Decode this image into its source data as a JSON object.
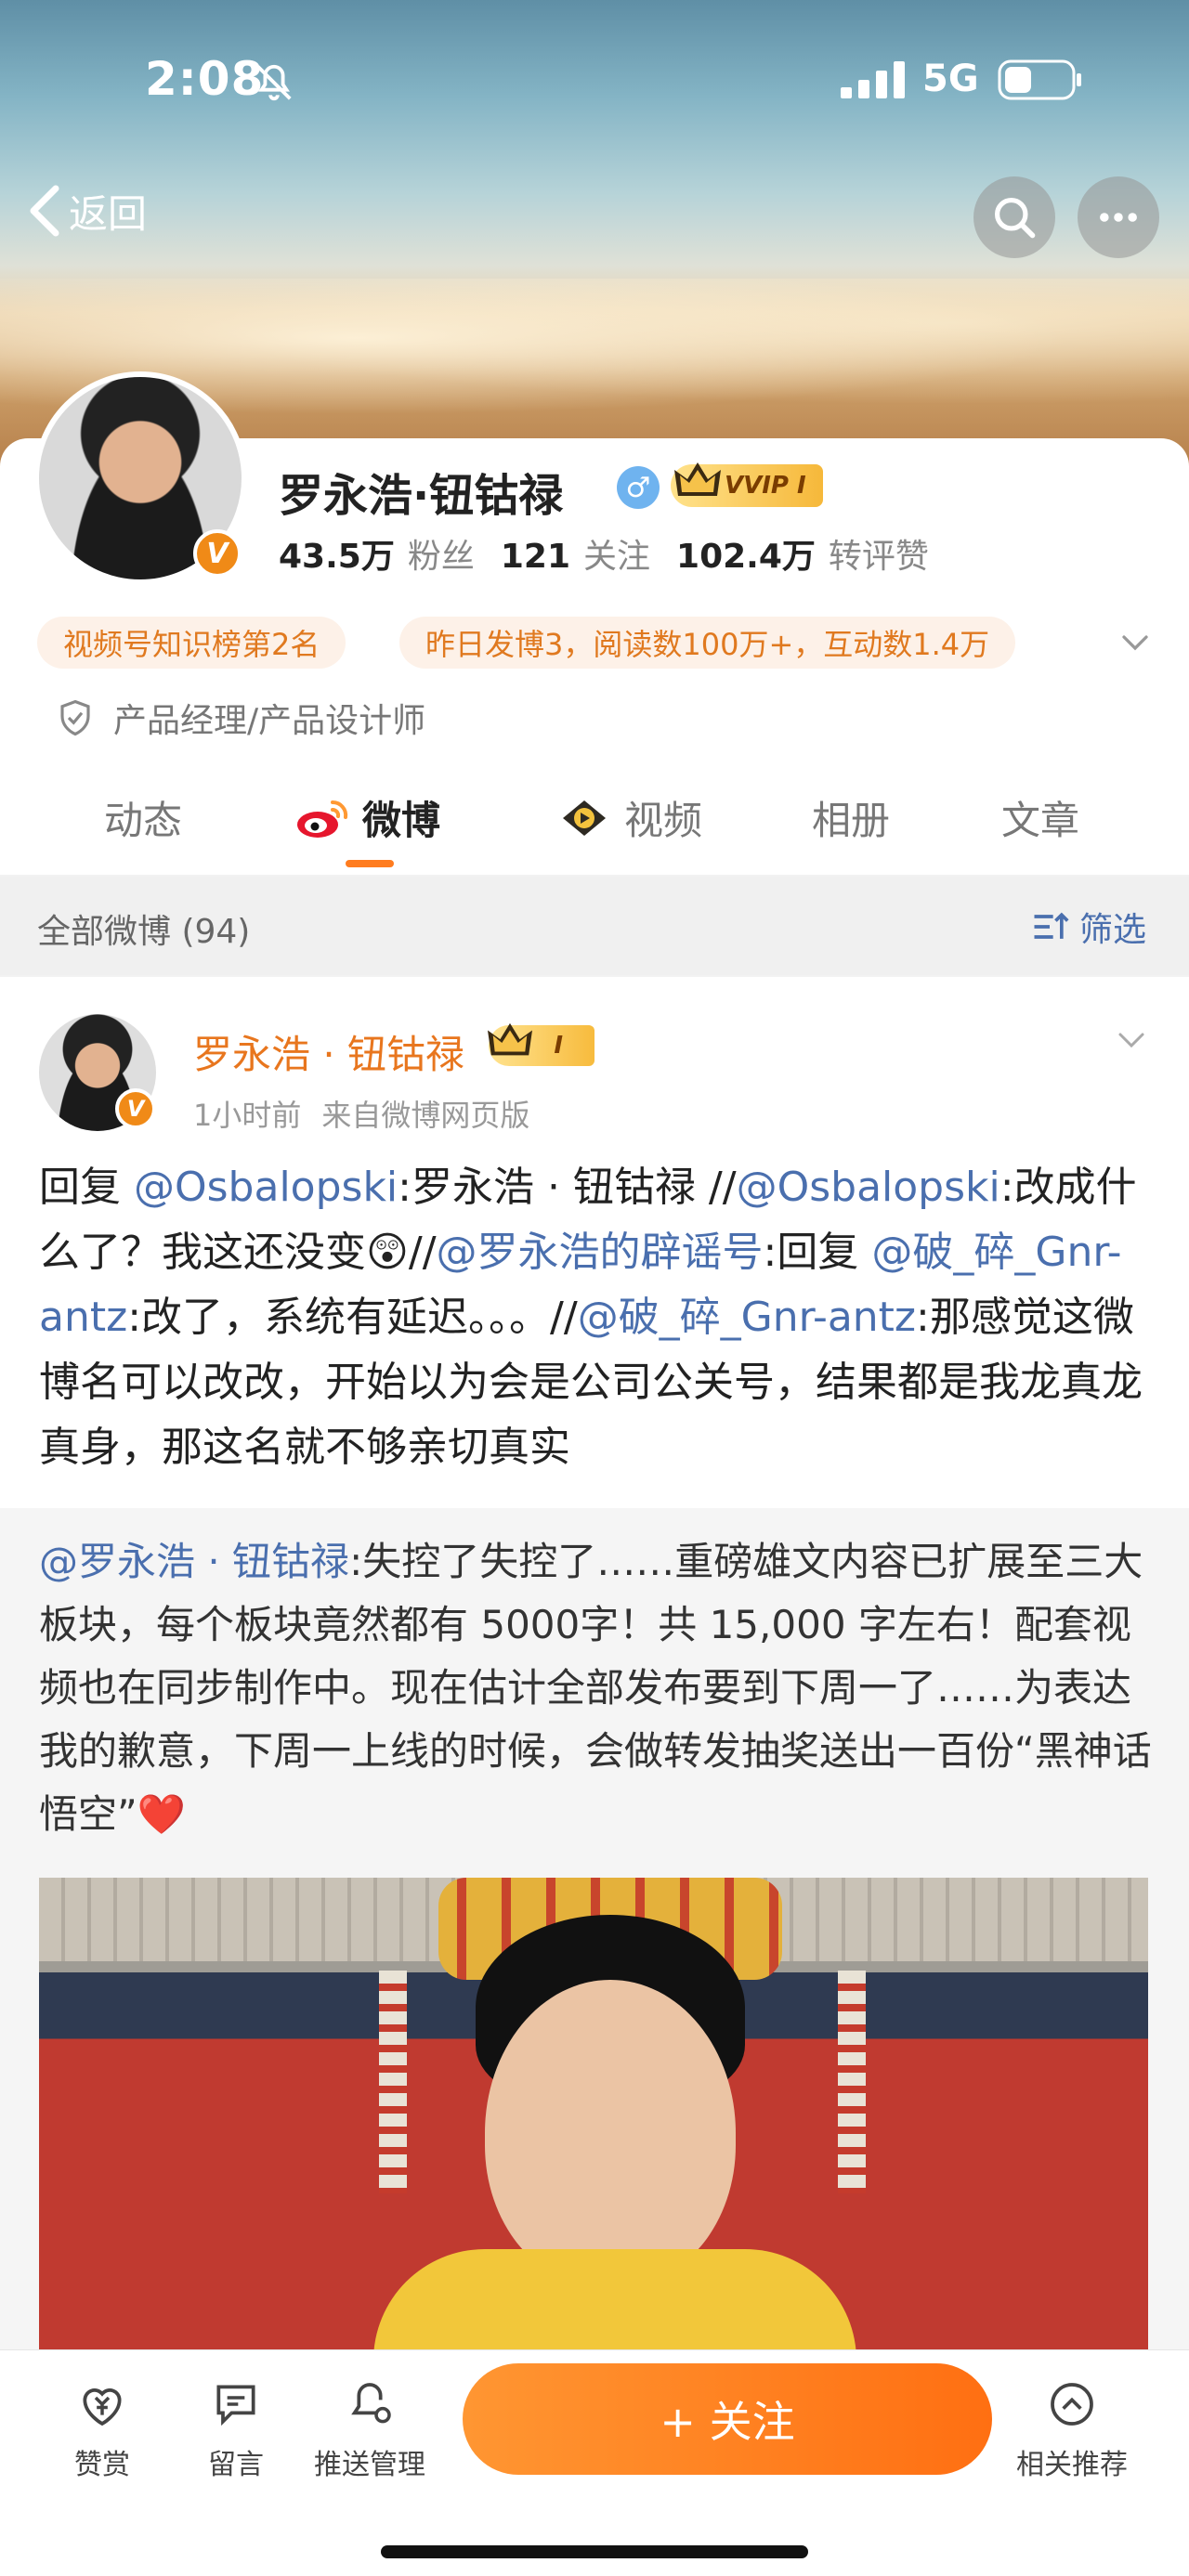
{
  "status_bar": {
    "time": "2:08",
    "network": "5G"
  },
  "nav": {
    "back_label": "返回"
  },
  "profile": {
    "name": "罗永浩·钮钴禄",
    "vip_label": "VVIP I",
    "stats": [
      {
        "value": "43.5万",
        "label": "粉丝"
      },
      {
        "value": "121",
        "label": "关注"
      },
      {
        "value": "102.4万",
        "label": "转评赞"
      }
    ],
    "tags": [
      "视频号知识榜第2名",
      "昨日发博3，阅读数100万+，互动数1.4万"
    ],
    "occupation": "产品经理/产品设计师"
  },
  "tabs": [
    {
      "label": "动态"
    },
    {
      "label": "微博"
    },
    {
      "label": "视频"
    },
    {
      "label": "相册"
    },
    {
      "label": "文章"
    }
  ],
  "filter": {
    "all_label": "全部微博 (94)",
    "filter_label": "筛选"
  },
  "post": {
    "author": "罗永浩 · 钮钴禄",
    "level": "I",
    "time": "1小时前",
    "source": "来自微博网页版",
    "segments": [
      {
        "t": "回复 ",
        "at": false
      },
      {
        "t": "@Osbalopski",
        "at": true
      },
      {
        "t": ":罗永浩 · 钮钴禄 //",
        "at": false
      },
      {
        "t": "@Osbalopski",
        "at": true
      },
      {
        "t": ":改成什么了？我这还没变😲//",
        "at": false
      },
      {
        "t": "@罗永浩的辟谣号",
        "at": true
      },
      {
        "t": ":回复 ",
        "at": false
      },
      {
        "t": "@破_碎_Gnr-antz",
        "at": true
      },
      {
        "t": ":改了，系统有延迟。。。//",
        "at": false
      },
      {
        "t": "@破_碎_Gnr-antz",
        "at": true
      },
      {
        "t": ":那感觉这微博名可以改改，开始以为会是公司公关号，结果都是我龙真龙真身，那这名就不够亲切真实",
        "at": false
      }
    ],
    "repost": {
      "at": "@罗永浩 · 钮钴禄",
      "text": ":失控了失控了……重磅雄文内容已扩展至三大板块，每个板块竟然都有 5000字！共 15,000 字左右！配套视频也在同步制作中。现在估计全部发布要到下周一了……为表达我的歉意，下周一上线的时候，会做转发抽奖送出一百份“黑神话悟空”",
      "emoji": "❤️"
    }
  },
  "bottom_bar": {
    "items": [
      {
        "label": "赞赏"
      },
      {
        "label": "留言"
      },
      {
        "label": "推送管理"
      },
      {
        "label": "相关推荐"
      }
    ],
    "follow_label": "+ 关注"
  }
}
